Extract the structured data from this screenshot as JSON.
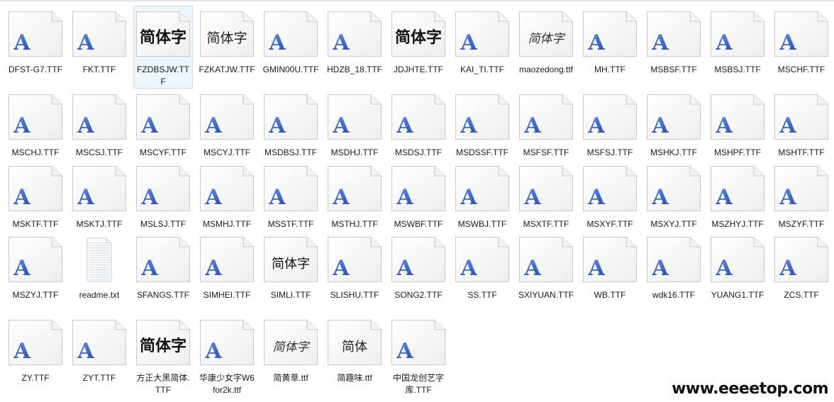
{
  "files": [
    {
      "name": "DFST-G7.TTF",
      "preview": "A"
    },
    {
      "name": "FKT.TTF",
      "preview": "A"
    },
    {
      "name": "FZDBSJW.TTF",
      "preview": "简体字",
      "pstyle": "bold",
      "selected": true
    },
    {
      "name": "FZKATJW.TTF",
      "preview": "简体字",
      "pstyle": "thin"
    },
    {
      "name": "GMIN00U.TTF",
      "preview": "A"
    },
    {
      "name": "HDZB_18.TTF",
      "preview": "A"
    },
    {
      "name": "JDJHTE.TTF",
      "preview": "简体字",
      "pstyle": "black"
    },
    {
      "name": "KAI_TI.TTF",
      "preview": "A"
    },
    {
      "name": "maozedong.ttf",
      "preview": "简体字",
      "pstyle": "script"
    },
    {
      "name": "MH.TTF",
      "preview": "A"
    },
    {
      "name": "MSBSF.TTF",
      "preview": "A"
    },
    {
      "name": "MSBSJ.TTF",
      "preview": "A"
    },
    {
      "name": "MSCHF.TTF",
      "preview": "A"
    },
    {
      "name": "MSCHJ.TTF",
      "preview": "A"
    },
    {
      "name": "MSCSJ.TTF",
      "preview": "A"
    },
    {
      "name": "MSCYF.TTF",
      "preview": "A"
    },
    {
      "name": "MSCYJ.TTF",
      "preview": "A"
    },
    {
      "name": "MSDBSJ.TTF",
      "preview": "A"
    },
    {
      "name": "MSDHJ.TTF",
      "preview": "A"
    },
    {
      "name": "MSDSJ.TTF",
      "preview": "A"
    },
    {
      "name": "MSDSSF.TTF",
      "preview": "A"
    },
    {
      "name": "MSFSF.TTF",
      "preview": "A"
    },
    {
      "name": "MSFSJ.TTF",
      "preview": "A"
    },
    {
      "name": "MSHKJ.TTF",
      "preview": "A"
    },
    {
      "name": "MSHPF.TTF",
      "preview": "A"
    },
    {
      "name": "MSHTF.TTF",
      "preview": "A"
    },
    {
      "name": "MSKTF.TTF",
      "preview": "A"
    },
    {
      "name": "MSKTJ.TTF",
      "preview": "A"
    },
    {
      "name": "MSLSJ.TTF",
      "preview": "A"
    },
    {
      "name": "MSMHJ.TTF",
      "preview": "A"
    },
    {
      "name": "MSSTF.TTF",
      "preview": "A"
    },
    {
      "name": "MSTHJ.TTF",
      "preview": "A"
    },
    {
      "name": "MSWBF.TTF",
      "preview": "A"
    },
    {
      "name": "MSWBJ.TTF",
      "preview": "A"
    },
    {
      "name": "MSXTF.TTF",
      "preview": "A"
    },
    {
      "name": "MSXYF.TTF",
      "preview": "A"
    },
    {
      "name": "MSXYJ.TTF",
      "preview": "A"
    },
    {
      "name": "MSZHYJ.TTF",
      "preview": "A"
    },
    {
      "name": "MSZYF.TTF",
      "preview": "A"
    },
    {
      "name": "MSZYJ.TTF",
      "preview": "A"
    },
    {
      "name": "readme.txt",
      "preview": "txt"
    },
    {
      "name": "SFANGS.TTF",
      "preview": "A"
    },
    {
      "name": "SIMHEI.TTF",
      "preview": "A"
    },
    {
      "name": "SIMLI.TTF",
      "preview": "简体字",
      "pstyle": "li"
    },
    {
      "name": "SLISHU.TTF",
      "preview": "A"
    },
    {
      "name": "SONG2.TTF",
      "preview": "A"
    },
    {
      "name": "SS.TTF",
      "preview": "A"
    },
    {
      "name": "SXIYUAN.TTF",
      "preview": "A"
    },
    {
      "name": "WB.TTF",
      "preview": "A"
    },
    {
      "name": "wdk16.TTF",
      "preview": "A"
    },
    {
      "name": "YUANG1.TTF",
      "preview": "A"
    },
    {
      "name": "ZCS.TTF",
      "preview": "A"
    },
    {
      "name": "ZY.TTF",
      "preview": "A"
    },
    {
      "name": "ZYT.TTF",
      "preview": "A"
    },
    {
      "name": "方正大黑简体.TTF",
      "preview": "简体字",
      "pstyle": "black"
    },
    {
      "name": "华康少女字W6 for2k.ttf",
      "preview": "A"
    },
    {
      "name": "简黄草.ttf",
      "preview": "简体字",
      "pstyle": "cursive"
    },
    {
      "name": "简趣味.ttf",
      "preview": "简体",
      "pstyle": "fun"
    },
    {
      "name": "中国龙创艺字库.TTF",
      "preview": "A"
    }
  ],
  "watermark": "www.eeeetop.com",
  "colors": {
    "selection_bg": "#eef6fd",
    "selection_border": "#c6ddf5",
    "font_icon_letter": "#2d5cc4",
    "label_text": "#1b1b1b"
  }
}
